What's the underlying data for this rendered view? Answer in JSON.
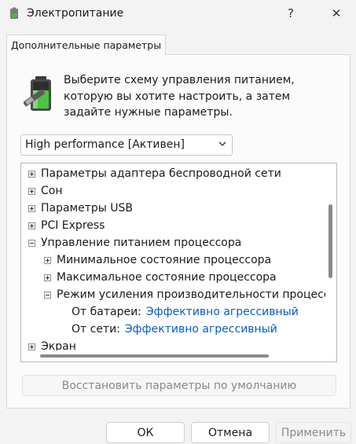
{
  "window": {
    "title": "Электропитание",
    "help_glyph": "?",
    "close_glyph": "✕"
  },
  "tabs": [
    {
      "label": "Дополнительные параметры",
      "selected": true
    }
  ],
  "description": "Выберите схему управления питанием, которую вы хотите настроить, а затем задайте нужные параметры.",
  "scheme_select": {
    "value": "High performance [Активен]"
  },
  "tree": {
    "rows": [
      {
        "label": "Параметры адаптера беспроводной сети",
        "expander": "plus",
        "level": 0
      },
      {
        "label": "Сон",
        "expander": "plus",
        "level": 0
      },
      {
        "label": "Параметры USB",
        "expander": "plus",
        "level": 0
      },
      {
        "label": "PCI Express",
        "expander": "plus",
        "level": 0
      },
      {
        "label": "Управление питанием процессора",
        "expander": "minus",
        "level": 0
      },
      {
        "label": "Минимальное состояние процессора",
        "expander": "plus",
        "level": 1
      },
      {
        "label": "Максимальное состояние процессора",
        "expander": "plus",
        "level": 1
      },
      {
        "label": "Режим усиления производительности процессора",
        "expander": "minus",
        "level": 1
      },
      {
        "label": "От батареи:",
        "value": "Эффективно агрессивный",
        "level": 2
      },
      {
        "label": "От сети:",
        "value": "Эффективно агрессивный",
        "level": 2
      },
      {
        "label": "Экран",
        "expander": "plus",
        "level": 0
      }
    ]
  },
  "buttons": {
    "restore": "Восстановить параметры по умолчанию",
    "ok": "ОК",
    "cancel": "Отмена",
    "apply": "Применить"
  },
  "colors": {
    "link": "#0a5cb8",
    "background": "#f3f3f3",
    "disabled_text": "#8a8a8a"
  },
  "icons": [
    "power-options-icon",
    "battery-settings-icon",
    "help-icon",
    "close-icon",
    "chevron-down-icon"
  ]
}
